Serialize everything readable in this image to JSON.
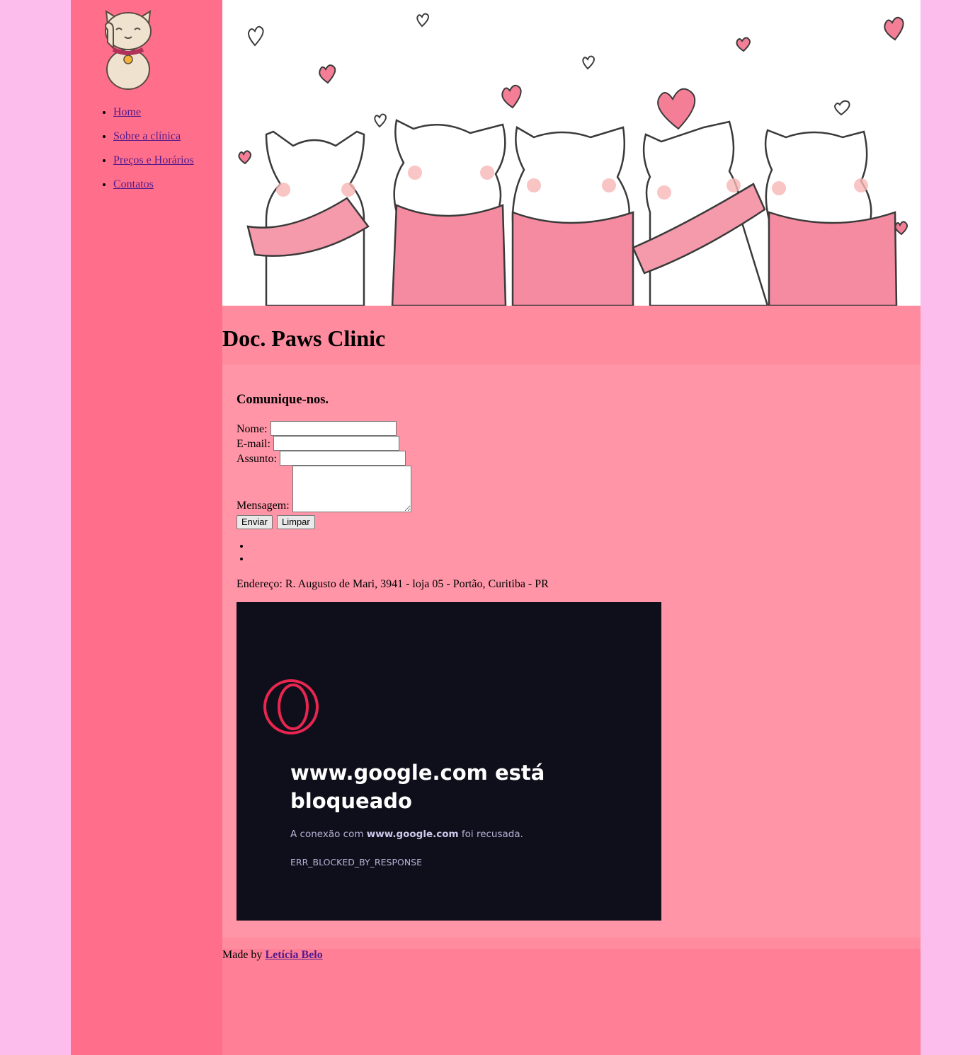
{
  "nav": {
    "items": [
      {
        "label": "Home"
      },
      {
        "label": "Sobre a clínica"
      },
      {
        "label": "Preços e Horários"
      },
      {
        "label": "Contatos"
      }
    ]
  },
  "header": {
    "title": "Doc. Paws Clinic"
  },
  "contact": {
    "heading": "Comunique-nos.",
    "name_label": "Nome:",
    "email_label": "E-mail:",
    "subject_label": "Assunto:",
    "message_label": "Mensagem:",
    "name_value": "",
    "email_value": "",
    "subject_value": "",
    "message_value": "",
    "submit_label": "Enviar",
    "reset_label": "Limpar"
  },
  "address": "Endereço: R. Augusto de Mari, 3941 - loja 05 - Portão, Curitiba - PR",
  "map_embed": {
    "error_title": "www.google.com está bloqueado",
    "error_prefix": "A conexão com ",
    "error_host": "www.google.com",
    "error_suffix": " foi recusada.",
    "error_code": "ERR_BLOCKED_BY_RESPONSE"
  },
  "footer": {
    "prefix": "Made by ",
    "author": "Letícia Belo"
  },
  "colors": {
    "sidebar": "#ff6f8b",
    "page_background": "#fdbdec",
    "content_background": "#ff95a7",
    "error_background": "#0f0e1b",
    "opera_red": "#e8264f"
  }
}
